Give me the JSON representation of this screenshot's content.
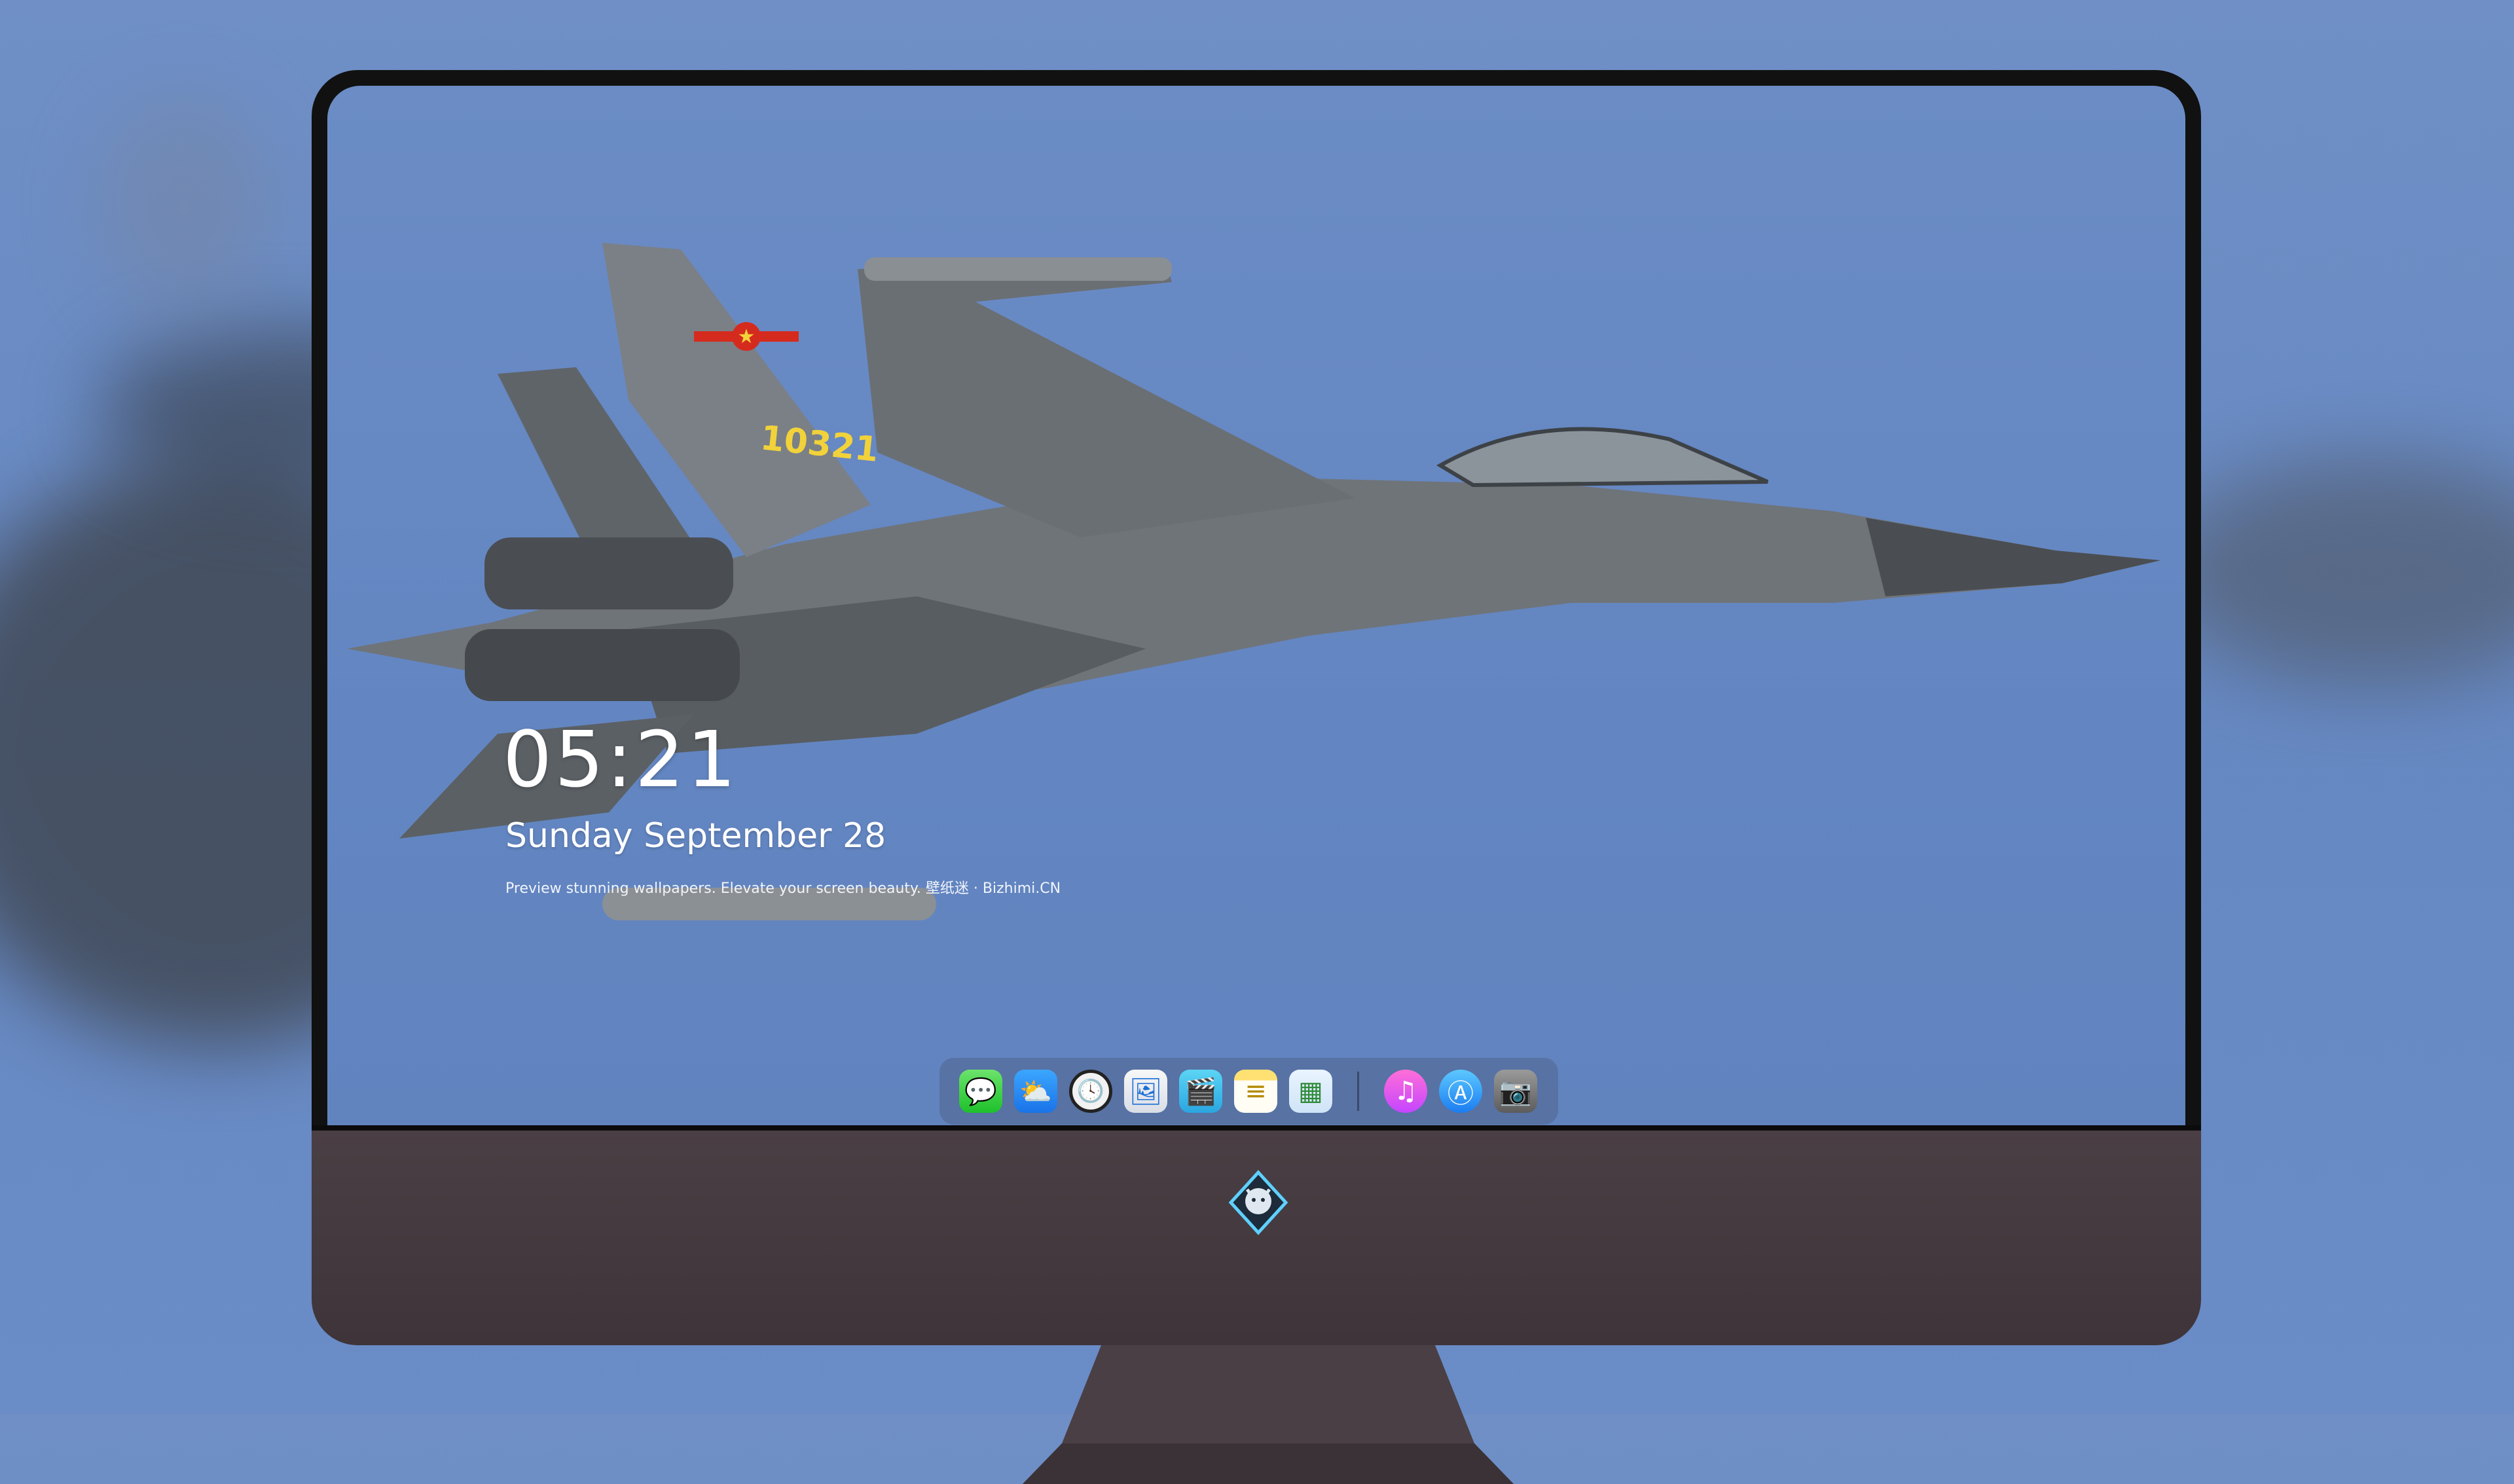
{
  "lock_screen": {
    "time": "05:21",
    "date": "Sunday September  28",
    "tagline": "Preview stunning wallpapers. Elevate your screen beauty. 壁纸迷 · Bizhimi.CN"
  },
  "jet": {
    "tail_number": "10321"
  },
  "dock": {
    "apps": [
      {
        "name": "Messages",
        "icon": "messages-icon",
        "glyph": "💬"
      },
      {
        "name": "Weather",
        "icon": "weather-icon",
        "glyph": "⛅"
      },
      {
        "name": "Clock",
        "icon": "clock-icon",
        "glyph": "🕓"
      },
      {
        "name": "Preview",
        "icon": "preview-icon",
        "glyph": "🖼"
      },
      {
        "name": "Claquette",
        "icon": "clapper-icon",
        "glyph": "🎬"
      },
      {
        "name": "Notes",
        "icon": "notes-icon",
        "glyph": "≡"
      },
      {
        "name": "Photos",
        "icon": "photos-icon",
        "glyph": "▦"
      },
      {
        "name": "iTunes",
        "icon": "music-icon",
        "glyph": "♫"
      },
      {
        "name": "App Store",
        "icon": "app-store-icon",
        "glyph": "Ⓐ"
      },
      {
        "name": "Camera",
        "icon": "camera-icon",
        "glyph": "📷"
      }
    ]
  },
  "colors": {
    "sky": "#6687c2",
    "bezel": "#111111",
    "chin": "#463c41",
    "jet_body": "#6b7075",
    "tail_number": "#f2d23a",
    "roundel_red": "#d52b1e"
  }
}
